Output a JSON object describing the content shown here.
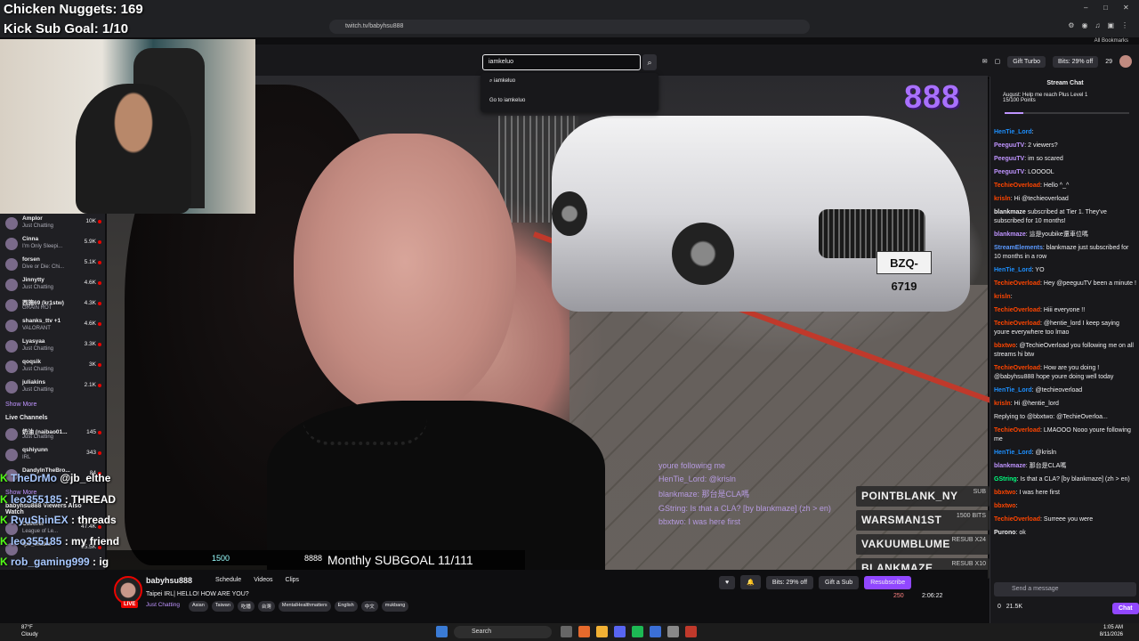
{
  "browser": {
    "url": "twitch.tv/babyhsu888",
    "bookmarks": "All Bookmarks"
  },
  "stream_overlay": {
    "nuggets": "Chicken Nuggets: 169",
    "kick_goal": "Kick Sub Goal: 1/10",
    "subgoal_text": "Monthly SUBGOAL 11/111",
    "bar_left1": "1500",
    "bar_left2": "8888",
    "logo": "888",
    "sub_list": [
      {
        "name": "POINTBLANK_NY",
        "tag": "SUB"
      },
      {
        "name": "WARSMAN1ST",
        "tag": "1500 BITS"
      },
      {
        "name": "VAKUUMBLUME",
        "tag": "RESUB X24"
      },
      {
        "name": "BLANKMAZE",
        "tag": "RESUB X10"
      }
    ],
    "plate": "BZQ-6719",
    "overlay_chat": [
      "youre following me",
      "HenTie_Lord: @krisln",
      "blankmaze: 那台是CLA嗎",
      "GString: Is that a CLA? [by blankmaze] (zh > en)",
      "bbxtwo: I was here first"
    ]
  },
  "kick_chat": [
    {
      "user": "TheDrMo",
      "text": " @jb_elthe"
    },
    {
      "user": "leo355185",
      "text": " : THREAD"
    },
    {
      "user": "RyuShinEX",
      "text": " : threads"
    },
    {
      "user": "leo355185",
      "text": " : my friend"
    },
    {
      "user": "rob_gaming999",
      "text": " : ig"
    }
  ],
  "top": {
    "search_value": "iamkeluo",
    "search_suggestion": "iamkeluo",
    "search_goto": "Go to iamkeluo",
    "gift_turbo": "Gift Turbo",
    "bits_offer": "Bits: 29% off",
    "notif_count": "29"
  },
  "sidebar": {
    "followed": [
      {
        "name": "Amplor",
        "game": "Just Chatting",
        "count": "10K"
      },
      {
        "name": "Cinna",
        "game": "I'm Only Sleepi...",
        "count": "5.9K"
      },
      {
        "name": "forsen",
        "game": "Dive or Die: Chi...",
        "count": "5.1K"
      },
      {
        "name": "Jinnytty",
        "game": "Just Chatting",
        "count": "4.6K"
      },
      {
        "name": "西施69 (kr1stw)",
        "game": "GRAIN ROT",
        "count": "4.3K"
      },
      {
        "name": "shanks_ttv +1",
        "game": "VALORANT",
        "count": "4.6K"
      },
      {
        "name": "Lyasyaa",
        "game": "Just Chatting",
        "count": "3.3K"
      },
      {
        "name": "qoqsik",
        "game": "Just Chatting",
        "count": "3K"
      },
      {
        "name": "juliakins",
        "game": "Just Chatting",
        "count": "2.1K"
      }
    ],
    "show_more": "Show More",
    "live_heading": "Live Channels",
    "live": [
      {
        "name": "奶油 (naibao01...",
        "game": "Just Chatting",
        "count": "145"
      },
      {
        "name": "qshiyunn",
        "game": "IRL",
        "count": "343"
      },
      {
        "name": "DandyInTheBro...",
        "game": "",
        "count": "84"
      }
    ],
    "viewers_watch": "babyhsu888 Viewers Also Watch",
    "also": [
      {
        "name": "Caedrel",
        "game": "League of Le...",
        "count": "47.4K"
      },
      {
        "name": "fps_shaka",
        "game": "",
        "count": "15.5K"
      }
    ]
  },
  "info": {
    "streamer": "babyhsu888",
    "title": "Taipei IRL| HELLO! HOW ARE YOU?",
    "category": "Just Chatting",
    "tags": [
      "Asian",
      "Taiwan",
      "吃播",
      "台灣",
      "MentalHealthmatters",
      "English",
      "中文",
      "mukbang"
    ],
    "nav": [
      "Schedule",
      "Videos",
      "Clips"
    ],
    "bits_btn": "Bits: 29% off",
    "gift_btn": "Gift a Sub",
    "resub_btn": "Resubscribe",
    "viewers": "250",
    "uptime": "2:06:22",
    "live": "LIVE"
  },
  "chat": {
    "header": "Stream Chat",
    "hype_title": "August: Help me reach Plus Level 1",
    "hype_points": "15/100 Points",
    "hype_progress": 0.15,
    "messages": [
      {
        "user": "HenTie_Lord",
        "color": "#1e90ff",
        "text": ": "
      },
      {
        "user": "PeeguuTV",
        "color": "#bf94ff",
        "text": ": 2 viewers?"
      },
      {
        "user": "PeeguuTV",
        "color": "#bf94ff",
        "text": ": im so scared"
      },
      {
        "user": "PeeguuTV",
        "color": "#bf94ff",
        "text": ": LOOOOL"
      },
      {
        "user": "TechieOverload",
        "color": "#ff4500",
        "text": ": Hello ^_^"
      },
      {
        "user": "krisln",
        "color": "#ff4500",
        "text": ": Hi @techieoverload"
      },
      {
        "user": "blankmaze",
        "color": "#efeff1",
        "text": " subscribed at Tier 1. They've subscribed for 10 months!"
      },
      {
        "user": "blankmaze",
        "color": "#bf94ff",
        "text": ": 這是youbike還車位嗎"
      },
      {
        "user": "StreamElements",
        "color": "#5b99ff",
        "text": ": blankmaze just subscribed for 10 months in a row"
      },
      {
        "user": "HenTie_Lord",
        "color": "#1e90ff",
        "text": ": YO"
      },
      {
        "user": "TechieOverload",
        "color": "#ff4500",
        "text": ": Hey @peeguuTV been a minute !"
      },
      {
        "user": "krisln",
        "color": "#ff4500",
        "text": ": "
      },
      {
        "user": "TechieOverload",
        "color": "#ff4500",
        "text": ": Hiii everyone !!"
      },
      {
        "user": "TechieOverload",
        "color": "#ff4500",
        "text": ": @hentie_lord I keep saying youre everywhere too lmao"
      },
      {
        "user": "bbxtwo",
        "color": "#ff4500",
        "text": ": @TechieOverload you following me on all streams hi btw"
      },
      {
        "user": "TechieOverload",
        "color": "#ff4500",
        "text": ": How are you doing ! @babyhsu888 hope youre doing well today"
      },
      {
        "user": "HenTie_Lord",
        "color": "#1e90ff",
        "text": ": @techieoverload"
      },
      {
        "user": "krisln",
        "color": "#ff4500",
        "text": ": Hi @hentie_lord"
      },
      {
        "user": "",
        "color": "#adadb8",
        "text": "Replying to @bbxtwo: @TechieOverloa..."
      },
      {
        "user": "TechieOverload",
        "color": "#ff4500",
        "text": ": LMAOOO Nooo youre following me"
      },
      {
        "user": "HenTie_Lord",
        "color": "#1e90ff",
        "text": ": @krisln"
      },
      {
        "user": "blankmaze",
        "color": "#bf94ff",
        "text": ": 那台是CLA嗎"
      },
      {
        "user": "GString",
        "color": "#00ff7f",
        "text": ": Is that a CLA? [by blankmaze] (zh > en)"
      },
      {
        "user": "bbxtwo",
        "color": "#ff4500",
        "text": ": I was here first"
      },
      {
        "user": "bbxtwo",
        "color": "#ff4500",
        "text": ": "
      },
      {
        "user": "TechieOverload",
        "color": "#ff4500",
        "text": ": Surreee you were"
      },
      {
        "user": "Purono",
        "color": "#efeff1",
        "text": ": ok"
      }
    ],
    "input_placeholder": "Send a message",
    "points1": "0",
    "points2": "21.5K",
    "chat_btn": "Chat"
  },
  "taskbar": {
    "weather_temp": "87°F",
    "weather_desc": "Cloudy",
    "search": "Search",
    "time": "1:05 AM",
    "date": "8/11/2026"
  }
}
